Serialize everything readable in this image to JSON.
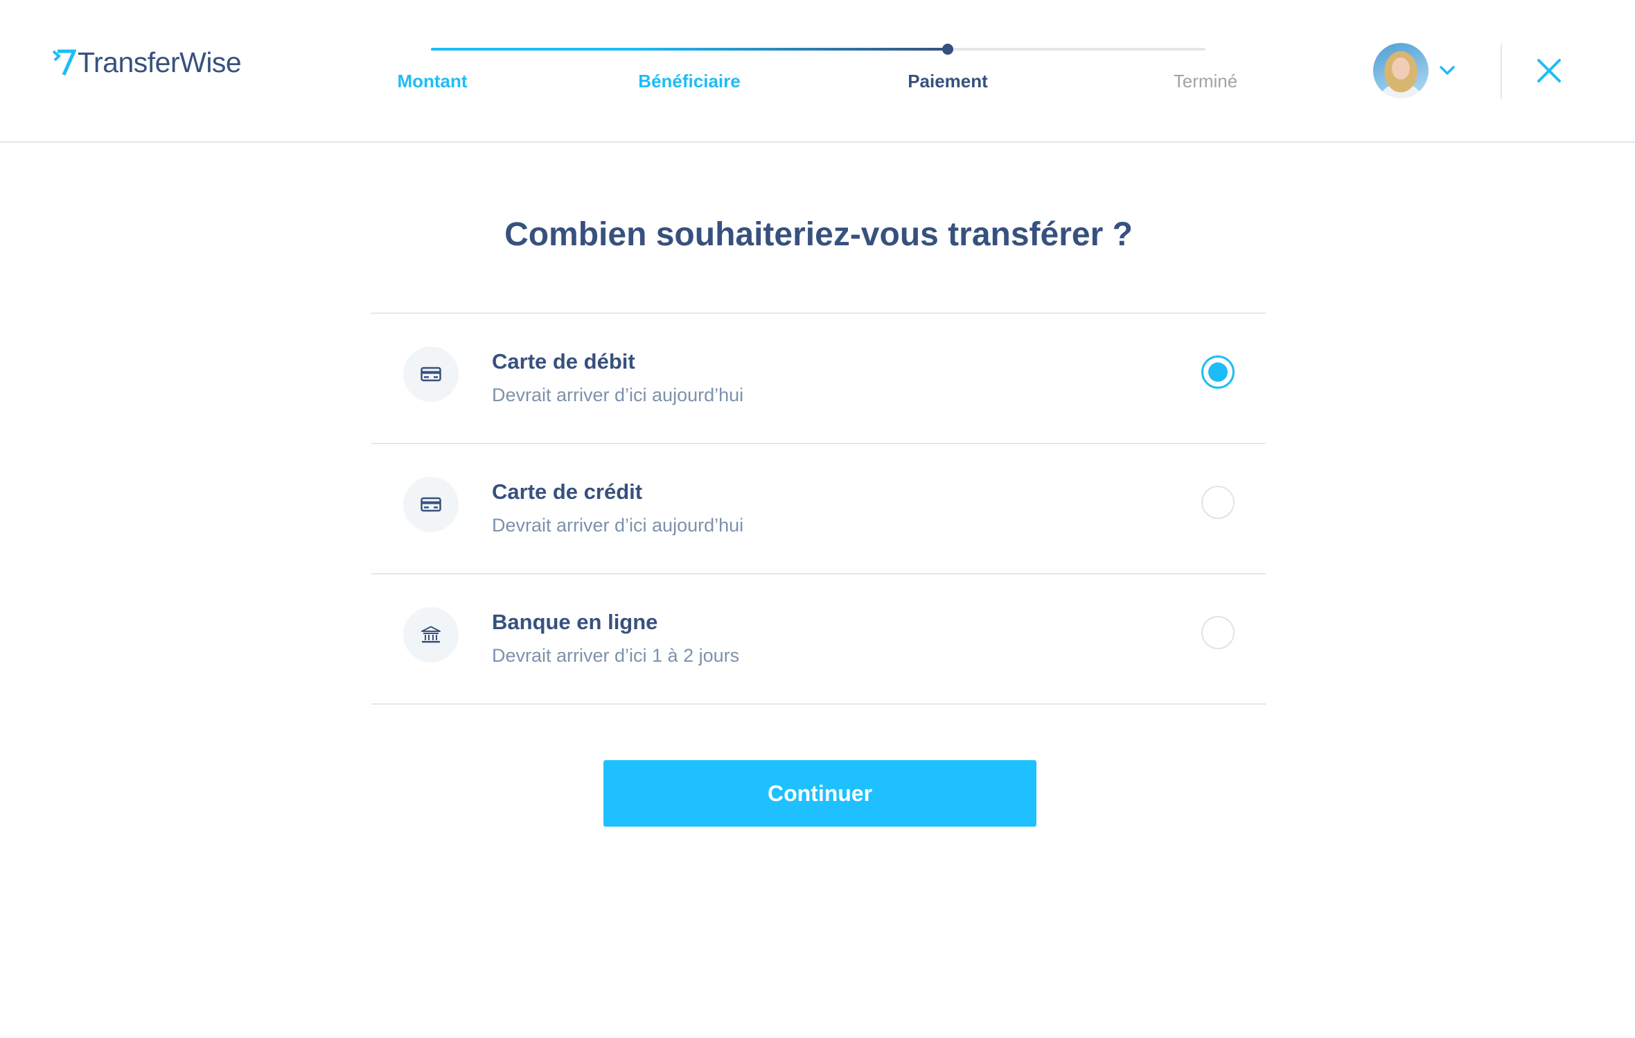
{
  "brand": {
    "name": "TransferWise"
  },
  "colors": {
    "accent": "#1ebcf6",
    "navy": "#37517e",
    "muted": "#7d91ab",
    "upcoming": "#a3a3a3",
    "button": "#1ec0ff"
  },
  "steps": [
    {
      "label": "Montant",
      "state": "done"
    },
    {
      "label": "Bénéficiaire",
      "state": "done"
    },
    {
      "label": "Paiement",
      "state": "current"
    },
    {
      "label": "Terminé",
      "state": "upcoming"
    }
  ],
  "progress": 0.667,
  "header": {
    "avatar": "user-avatar",
    "menu_icon": "chevron-down-icon",
    "close_icon": "close-icon"
  },
  "title": "Combien souhaiteriez-vous transférer ?",
  "payment_methods": [
    {
      "label": "Carte de débit",
      "eta": "Devrait arriver d’ici aujourd’hui",
      "icon": "card-icon",
      "selected": true
    },
    {
      "label": "Carte de crédit",
      "eta": "Devrait arriver d’ici aujourd’hui",
      "icon": "card-icon",
      "selected": false
    },
    {
      "label": "Banque en ligne",
      "eta": "Devrait arriver d’ici 1 à 2 jours",
      "icon": "bank-icon",
      "selected": false
    }
  ],
  "continue_label": "Continuer"
}
